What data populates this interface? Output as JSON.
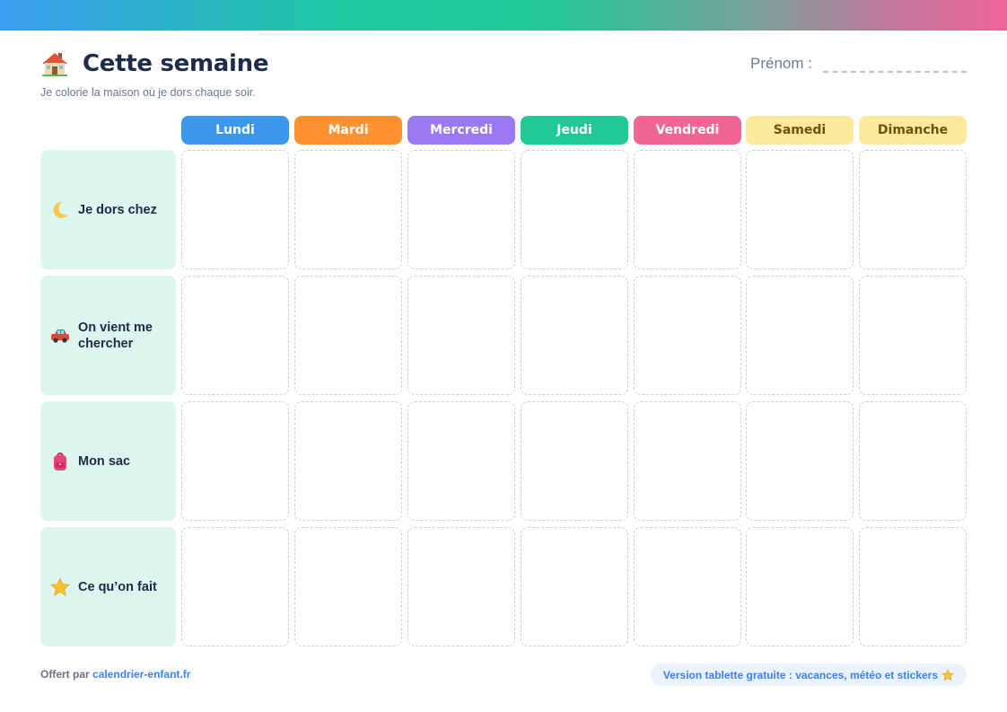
{
  "header": {
    "title": "Cette semaine",
    "subtitle": "Je colorie la maison où je dors chaque soir.",
    "prenom_label": "Prénom :",
    "title_icon": "house-icon"
  },
  "days": [
    {
      "label": "Lundi",
      "color": "#3a97ec",
      "text_color": "#ffffff"
    },
    {
      "label": "Mardi",
      "color": "#ff9230",
      "text_color": "#ffffff"
    },
    {
      "label": "Mercredi",
      "color": "#9b79f2",
      "text_color": "#ffffff"
    },
    {
      "label": "Jeudi",
      "color": "#22c894",
      "text_color": "#ffffff"
    },
    {
      "label": "Vendredi",
      "color": "#f06594",
      "text_color": "#ffffff"
    },
    {
      "label": "Samedi",
      "color": "#fde99a",
      "text_color": "#6b5410"
    },
    {
      "label": "Dimanche",
      "color": "#fde99a",
      "text_color": "#6b5410"
    }
  ],
  "rows": [
    {
      "label": "Je dors chez",
      "icon": "moon-icon"
    },
    {
      "label": "On vient me chercher",
      "icon": "car-icon"
    },
    {
      "label": "Mon sac",
      "icon": "backpack-icon"
    },
    {
      "label": "Ce qu’on fait",
      "icon": "star-icon"
    }
  ],
  "footer": {
    "offered_by": "Offert par",
    "site": "calendrier-enfant.fr",
    "promo": "Version tablette gratuite : vacances, météo et stickers",
    "promo_icon": "star-icon"
  },
  "colors": {
    "row_label_bg": "#dcf5ee",
    "accent": "#3b82f6"
  }
}
